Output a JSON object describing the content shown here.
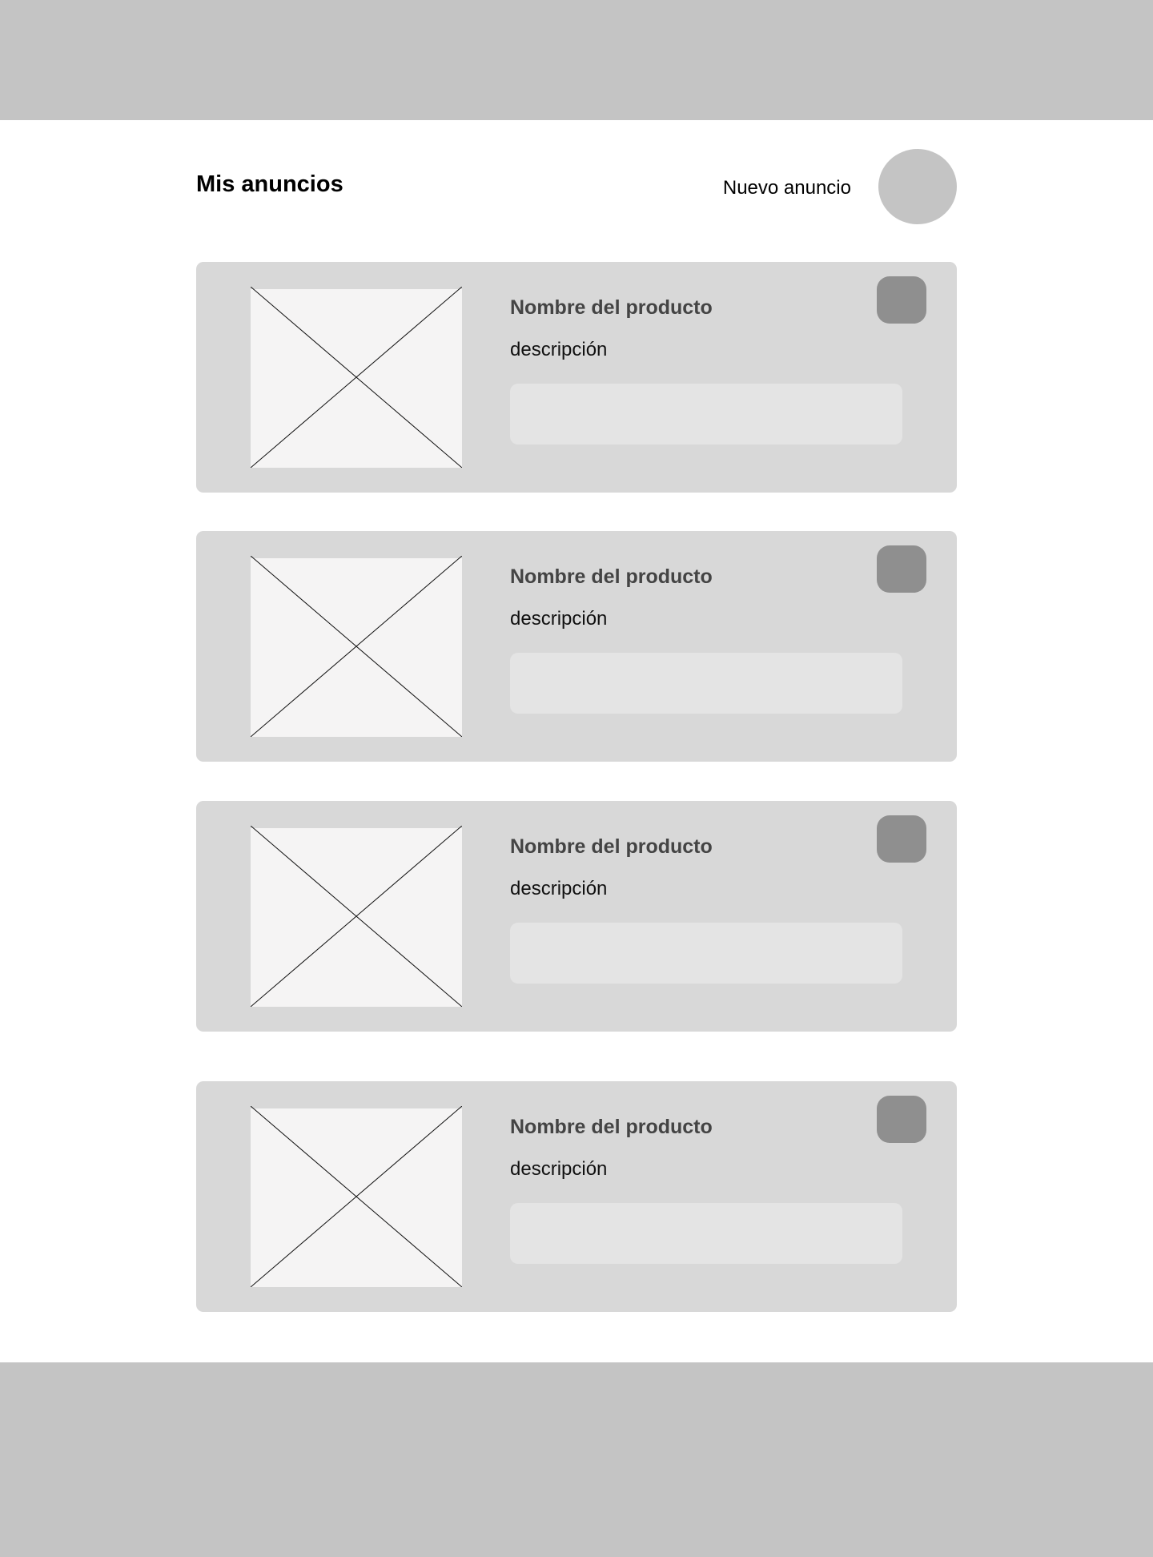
{
  "header": {
    "title": "Mis anuncios",
    "new_ad_label": "Nuevo anuncio"
  },
  "ads": [
    {
      "name": "Nombre del producto",
      "description": "descripción"
    },
    {
      "name": "Nombre del producto",
      "description": "descripción"
    },
    {
      "name": "Nombre del producto",
      "description": "descripción"
    },
    {
      "name": "Nombre del producto",
      "description": "descripción"
    }
  ],
  "colors": {
    "bars": "#c4c4c4",
    "card_background": "#d8d8d8",
    "card_field": "#e4e4e4",
    "action_button": "#8f8f8f",
    "image_placeholder": "#f5f4f4"
  },
  "icons": {
    "image_placeholder": "image-placeholder-icon"
  }
}
